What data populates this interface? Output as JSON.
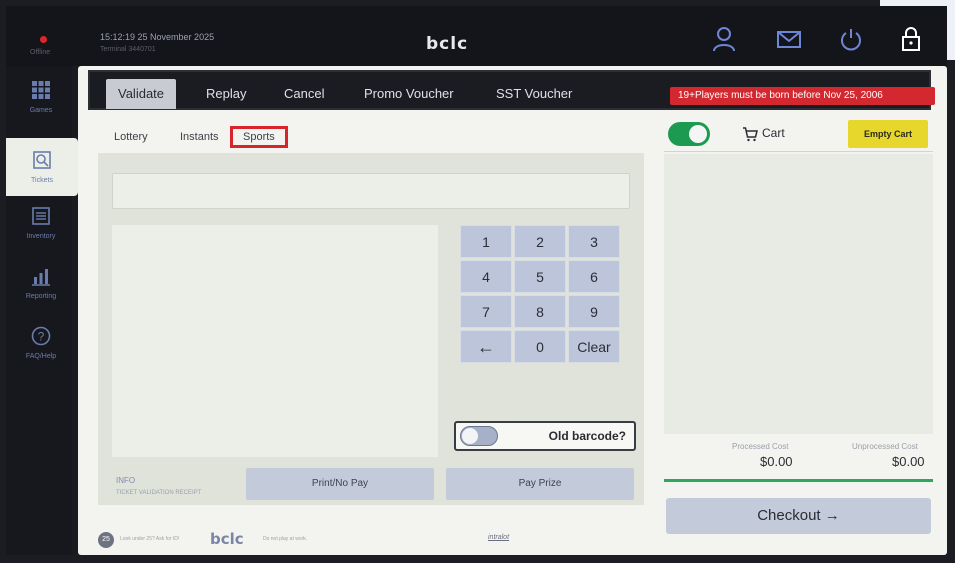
{
  "colors": {
    "accent_red": "#d8242b",
    "toggle_on": "#1d9a52",
    "empty_cart_yellow": "#e7d62b",
    "button_muted": "#c3cbdb"
  },
  "topbar": {
    "status": "Offline",
    "clock": "15:12:19  25 November 2025",
    "terminal": "Terminal 3440701",
    "brand": "bclc",
    "icons": [
      "user-icon",
      "mail-icon",
      "power-icon",
      "lock-icon"
    ]
  },
  "rail": {
    "items": [
      {
        "label": "Games",
        "icon": "grid-icon"
      },
      {
        "label": "Tickets",
        "icon": "search-ticket-icon"
      },
      {
        "label": "Inventory",
        "icon": "inventory-icon"
      },
      {
        "label": "Reporting",
        "icon": "bar-chart-icon"
      },
      {
        "label": "FAQ/Help",
        "icon": "help-icon"
      }
    ]
  },
  "tabs": {
    "items": [
      "Validate",
      "Replay",
      "Cancel",
      "Promo Voucher",
      "SST Voucher"
    ],
    "active": "Validate",
    "age_banner": "19+Players must be born before Nov 25, 2006"
  },
  "subtabs": {
    "items": [
      "Lottery",
      "Instants",
      "Sports"
    ],
    "active": "Sports"
  },
  "validate": {
    "barcode_value": "",
    "keypad": [
      "1",
      "2",
      "3",
      "4",
      "5",
      "6",
      "7",
      "8",
      "9",
      "←",
      "0",
      "Clear"
    ],
    "old_barcode_label": "Old barcode?",
    "info_title": "INFO",
    "info_sub": "TICKET VALIDATION RECEIPT",
    "print_no_pay": "Print/No Pay",
    "pay_prize": "Pay Prize"
  },
  "cart": {
    "title": "Cart",
    "empty_label": "Empty Cart",
    "processed_label": "Processed Cost",
    "processed_value": "$0.00",
    "unprocessed_label": "Unprocessed Cost",
    "unprocessed_value": "$0.00",
    "checkout_label": "Checkout →"
  },
  "footer": {
    "age_badge": "25",
    "text_left": "Look under 25? Ask for ID!",
    "logo": "bclc",
    "text_right": "Do not play at work.",
    "intralot": "intralot"
  }
}
